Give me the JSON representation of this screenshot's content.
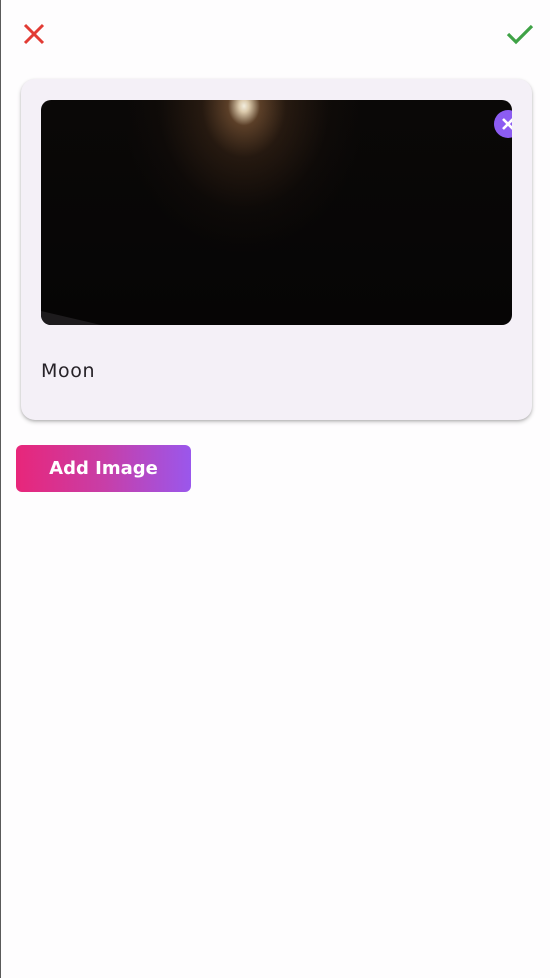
{
  "header": {
    "close_icon": "close-icon",
    "close_color": "#e23b34",
    "confirm_icon": "check-icon",
    "confirm_color": "#3fa246"
  },
  "image_card": {
    "remove_icon": "close-circle-icon",
    "remove_color": "#8c5cf2",
    "caption": "Moon"
  },
  "actions": {
    "add_image_label": "Add Image",
    "gradient_start": "#e8267a",
    "gradient_end": "#9a57ec"
  }
}
